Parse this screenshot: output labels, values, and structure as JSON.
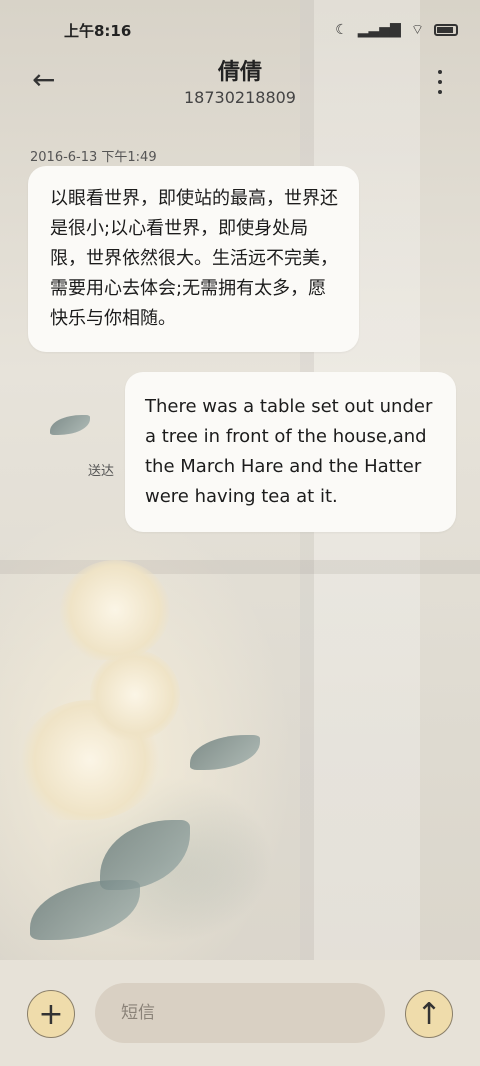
{
  "status_bar": {
    "time": "上午8:16",
    "icons": [
      "moon-icon",
      "signal-icon",
      "wifi-icon",
      "battery-icon"
    ]
  },
  "header": {
    "contact_name": "倩倩",
    "phone_number": "18730218809"
  },
  "conversation": {
    "timestamp": "2016-6-13 下午1:49",
    "messages": [
      {
        "direction": "incoming",
        "text": "以眼看世界，即使站的最高，世界还是很小;以心看世界，即使身处局限，世界依然很大。生活远不完美，需要用心去体会;无需拥有太多，愿快乐与你相随。"
      },
      {
        "direction": "outgoing",
        "text": "There was a table set out under a tree in front of the house,and the March Hare and the Hatter were having tea at it.",
        "status": "送达"
      }
    ]
  },
  "input_bar": {
    "placeholder": "短信"
  },
  "colors": {
    "button_fill": "#efdcab",
    "input_fill": "#d9d0c3",
    "bubble_fill": "#fbfaf7"
  }
}
